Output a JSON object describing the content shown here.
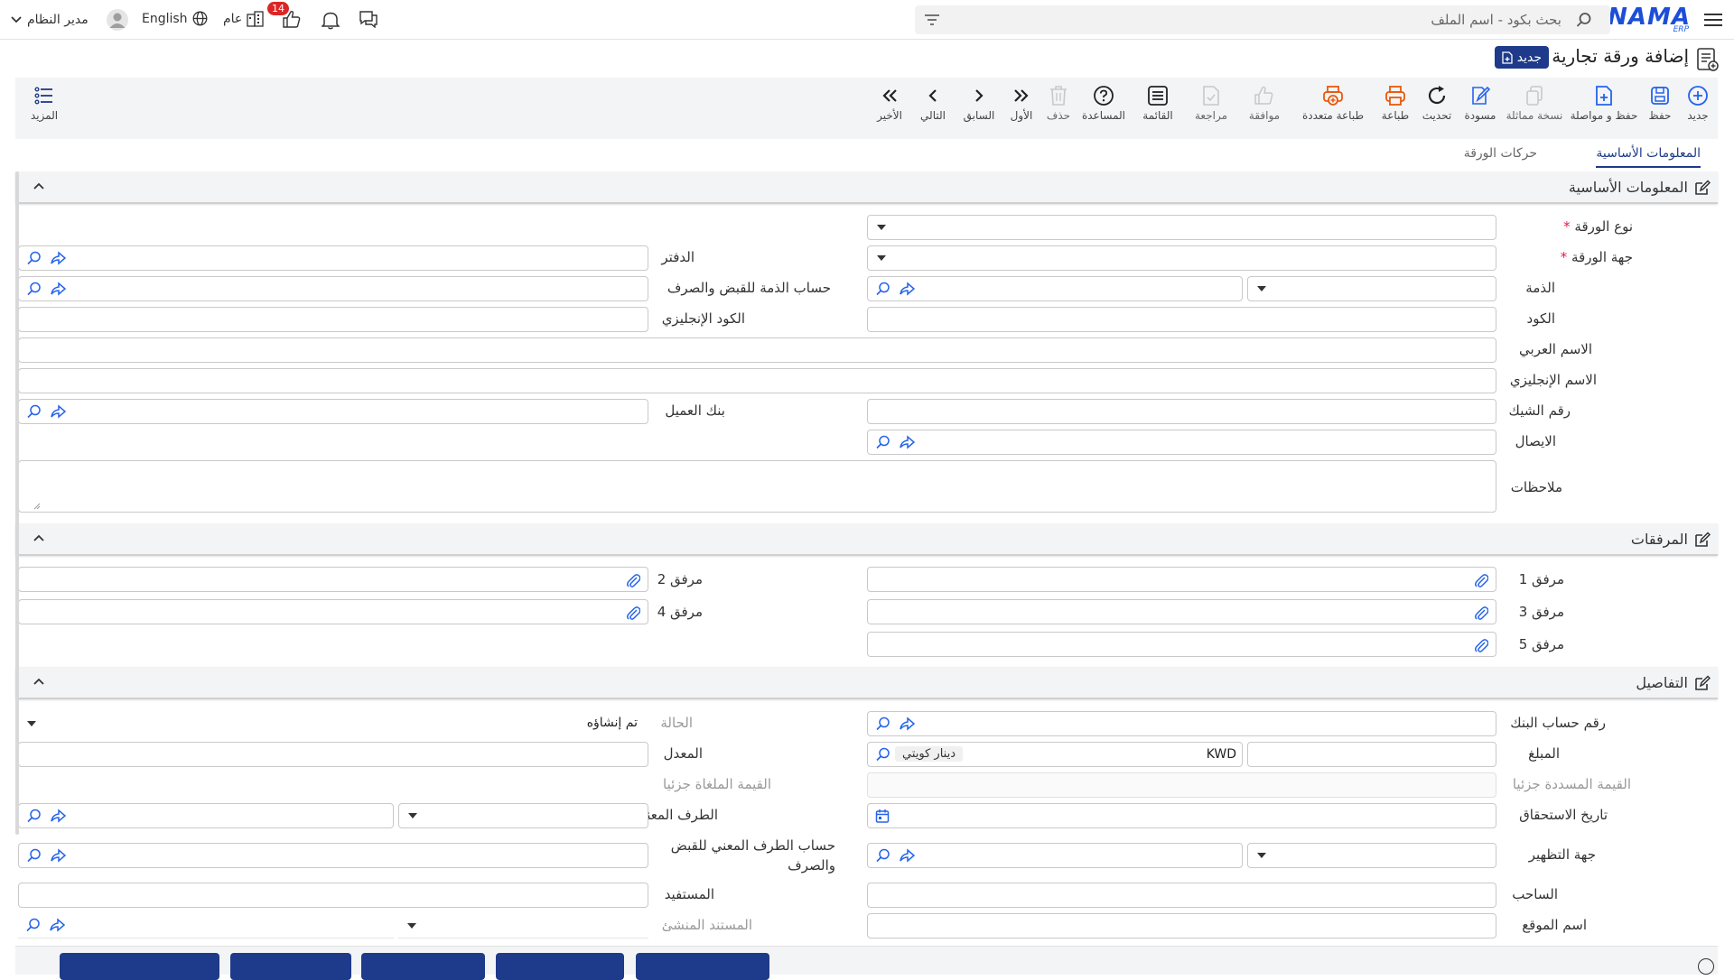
{
  "header": {
    "logo_text": "NAMA",
    "logo_sub": "ERP",
    "search_placeholder": "بحث بكود - اسم الملف",
    "notification_count": "14",
    "general_label": "عام",
    "language_label": "English",
    "user_name": "مدير النظام"
  },
  "page": {
    "title": "إضافة ورقة تجارية",
    "mode_badge": "جديد"
  },
  "toolbar": {
    "new": "جديد",
    "save": "حفظ",
    "save_continue": "حفظ و مواصلة",
    "copy": "نسخة مماثلة",
    "draft": "مسودة",
    "refresh": "تحديث",
    "print": "طباعة",
    "multi_print": "طباعة متعددة",
    "approve": "موافقة",
    "review": "مراجعة",
    "list": "القائمة",
    "help": "المساعدة",
    "delete": "حذف",
    "first": "الأول",
    "previous": "السابق",
    "next": "التالي",
    "last": "الأخير",
    "more": "المزيد"
  },
  "tabs": {
    "basic": "المعلومات الأساسية",
    "movements": "حركات الورقة"
  },
  "sections": {
    "basic": "المعلومات الأساسية",
    "attachments": "المرفقات",
    "details": "التفاصيل"
  },
  "basic": {
    "paper_type": "نوع الورقة",
    "paper_party": "جهة الورقة",
    "receivable": "الذمة",
    "code": "الكود",
    "arabic_name": "الاسم العربي",
    "english_name": "الاسم الإنجليزي",
    "check_number": "رقم الشيك",
    "receipt": "الايصال",
    "notes": "ملاحظات",
    "book": "الدفتر",
    "receivable_account": "حساب الذمة للقبض والصرف",
    "english_code": "الكود الإنجليزي",
    "client_bank": "بنك العميل"
  },
  "attachments": {
    "a1": "مرفق 1",
    "a2": "مرفق 2",
    "a3": "مرفق 3",
    "a4": "مرفق 4",
    "a5": "مرفق 5"
  },
  "details": {
    "bank_account_no": "رقم حساب البنك",
    "amount": "المبلغ",
    "currency_code": "KWD",
    "currency_name": "دينار كويتي",
    "partial_paid": "القيمة المسددة جزئيا",
    "due_date": "تاريخ الاستحقاق",
    "endorsement_party": "جهة التظهير",
    "drawer": "الساحب",
    "site_name": "اسم الموقع",
    "status": "الحالة",
    "status_value": "تم إنشاؤه",
    "rate": "المعدل",
    "partial_cancelled": "القيمة الملغاة جزئيا",
    "concerned_party": "الطرف المعني",
    "concerned_account": "حساب الطرف المعني للقبض والصرف",
    "beneficiary": "المستفيد",
    "source_doc": "المستند المنشئ"
  },
  "colors": {
    "primary": "#1e3a8a",
    "accent": "#2563eb",
    "print_orange": "#ea580c",
    "badge_red": "#dc2626",
    "toolbar_bg": "#f3f4f6"
  }
}
